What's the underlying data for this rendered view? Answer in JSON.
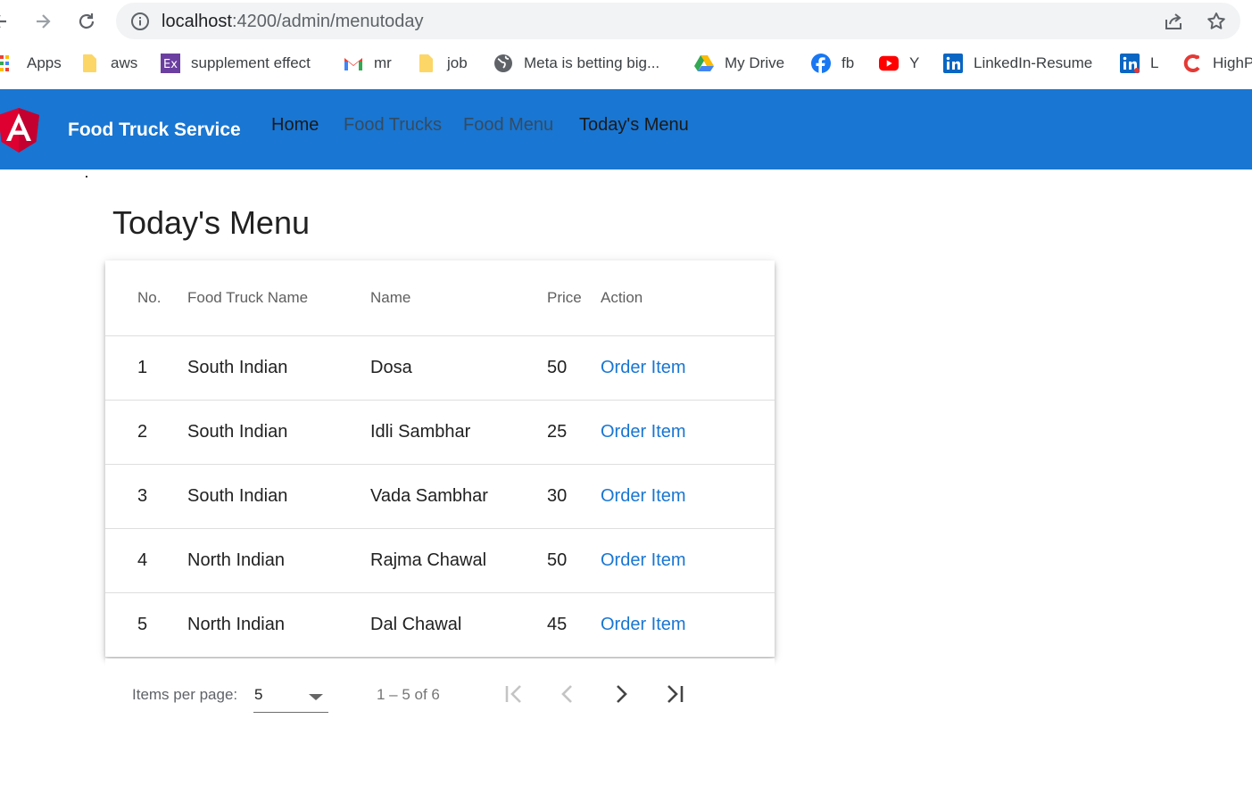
{
  "browser": {
    "url_host": "localhost",
    "url_path": ":4200/admin/menutoday",
    "bookmarks": [
      {
        "label": "Apps",
        "icon": "apps-grid-icon"
      },
      {
        "label": "aws",
        "icon": "folder-icon"
      },
      {
        "label": "supplement effect",
        "icon": "ex-logo-icon"
      },
      {
        "label": "mr",
        "icon": "gmail-icon"
      },
      {
        "label": "job",
        "icon": "folder-icon"
      },
      {
        "label": "Meta is betting big...",
        "icon": "globe-icon"
      },
      {
        "label": "My Drive",
        "icon": "google-drive-icon"
      },
      {
        "label": "fb",
        "icon": "facebook-icon"
      },
      {
        "label": "Y",
        "icon": "youtube-icon"
      },
      {
        "label": "LinkedIn-Resume",
        "icon": "linkedin-icon"
      },
      {
        "label": "L",
        "icon": "linkedin-icon"
      },
      {
        "label": "HighP",
        "icon": "c-logo-icon"
      }
    ]
  },
  "toolbar": {
    "brand": "Food Truck Service",
    "nav": [
      "Home",
      "Food Trucks",
      "Food Menu",
      "Today's Menu"
    ]
  },
  "page": {
    "title": "Today's Menu"
  },
  "table": {
    "columns": [
      "No.",
      "Food Truck Name",
      "Name",
      "Price",
      "Action"
    ],
    "rows": [
      {
        "no": "1",
        "truck": "South Indian",
        "name": "Dosa",
        "price": "50",
        "action": "Order Item"
      },
      {
        "no": "2",
        "truck": "South Indian",
        "name": "Idli Sambhar",
        "price": "25",
        "action": "Order Item"
      },
      {
        "no": "3",
        "truck": "South Indian",
        "name": "Vada Sambhar",
        "price": "30",
        "action": "Order Item"
      },
      {
        "no": "4",
        "truck": "North Indian",
        "name": "Rajma Chawal",
        "price": "50",
        "action": "Order Item"
      },
      {
        "no": "5",
        "truck": "North Indian",
        "name": "Dal Chawal",
        "price": "45",
        "action": "Order Item"
      }
    ]
  },
  "paginator": {
    "label": "Items per page:",
    "page_size": "5",
    "range": "1 – 5 of 6"
  },
  "colors": {
    "primary": "#1976d2",
    "angular_red": "#dd0031"
  }
}
